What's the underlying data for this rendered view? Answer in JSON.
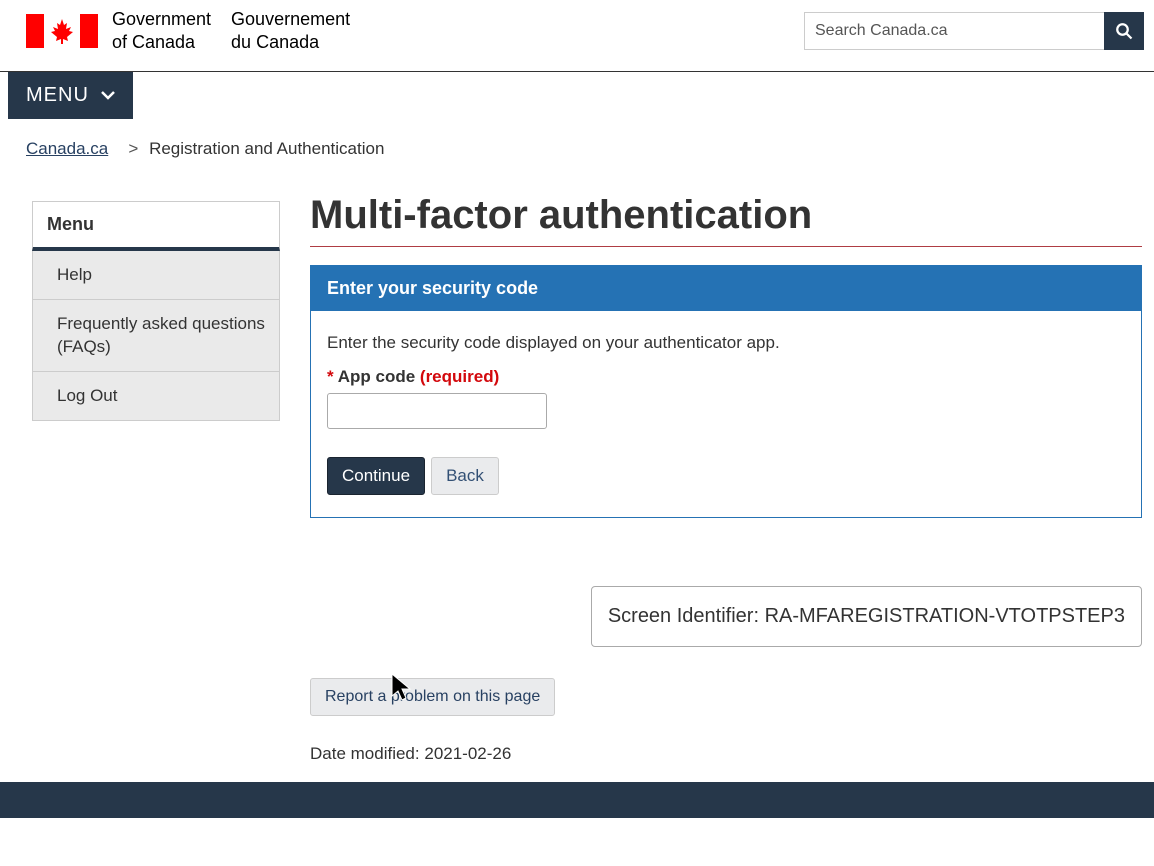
{
  "header": {
    "gov_en_1": "Government",
    "gov_en_2": "of Canada",
    "gov_fr_1": "Gouvernement",
    "gov_fr_2": "du Canada",
    "search_placeholder": "Search Canada.ca"
  },
  "menu_button": "MENU",
  "breadcrumb": {
    "home": "Canada.ca",
    "current": "Registration and Authentication"
  },
  "sidebar": {
    "title": "Menu",
    "items": [
      {
        "label": "Help"
      },
      {
        "label": "Frequently asked questions (FAQs)"
      },
      {
        "label": "Log Out"
      }
    ]
  },
  "main": {
    "title": "Multi-factor authentication",
    "panel_title": "Enter your security code",
    "instruction": "Enter the security code displayed on your authenticator app.",
    "field_star": "*",
    "field_label": "App code",
    "field_required": "(required)",
    "continue": "Continue",
    "back": "Back",
    "screen_id_label": "Screen Identifier:",
    "screen_id_value": "RA-MFAREGISTRATION-VTOTPSTEP3",
    "report_problem": "Report a problem on this page",
    "date_modified_label": "Date modified:",
    "date_modified_value": "2021-02-26"
  }
}
